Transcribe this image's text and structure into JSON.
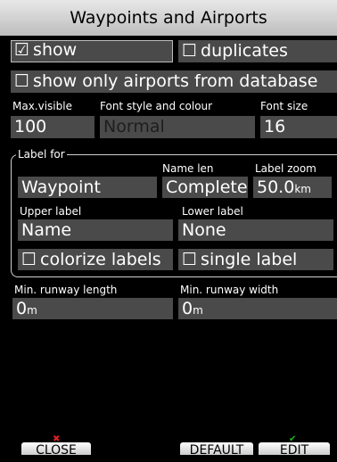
{
  "title": "Waypoints and Airports",
  "checkboxes": {
    "show": {
      "label": "show",
      "checked": true,
      "glyph": "☑"
    },
    "duplicates": {
      "label": "duplicates",
      "checked": false,
      "glyph": "☐"
    },
    "only_airports": {
      "label": "show only airports from database",
      "checked": false,
      "glyph": "☐"
    },
    "colorize": {
      "label": "colorize labels",
      "checked": false,
      "glyph": "☐"
    },
    "single": {
      "label": "single label",
      "checked": false,
      "glyph": "☐"
    }
  },
  "max_visible": {
    "label": "Max.visible",
    "value": "100"
  },
  "font_style": {
    "label": "Font style and colour",
    "value": "Normal"
  },
  "font_size": {
    "label": "Font size",
    "value": "16"
  },
  "label_for": {
    "title": "Label for",
    "value": "Waypoint",
    "name_len": {
      "label": "Name len",
      "value": "Complete"
    },
    "label_zoom": {
      "label": "Label zoom",
      "value": "50.0",
      "unit": "km"
    },
    "upper": {
      "label": "Upper label",
      "value": "Name"
    },
    "lower": {
      "label": "Lower label",
      "value": "None"
    }
  },
  "min_runway_length": {
    "label": "Min. runway length",
    "value": "0",
    "unit": "m"
  },
  "min_runway_width": {
    "label": "Min. runway width",
    "value": "0",
    "unit": "m"
  },
  "buttons": {
    "close": "CLOSE",
    "default": "DEFAULT",
    "edit": "EDIT"
  },
  "colors": {
    "field": "#4a4a4a",
    "title_bar": "#d9d9d9",
    "background": "#000000",
    "close_mark": "#e02020",
    "edit_mark": "#1eb41e"
  }
}
